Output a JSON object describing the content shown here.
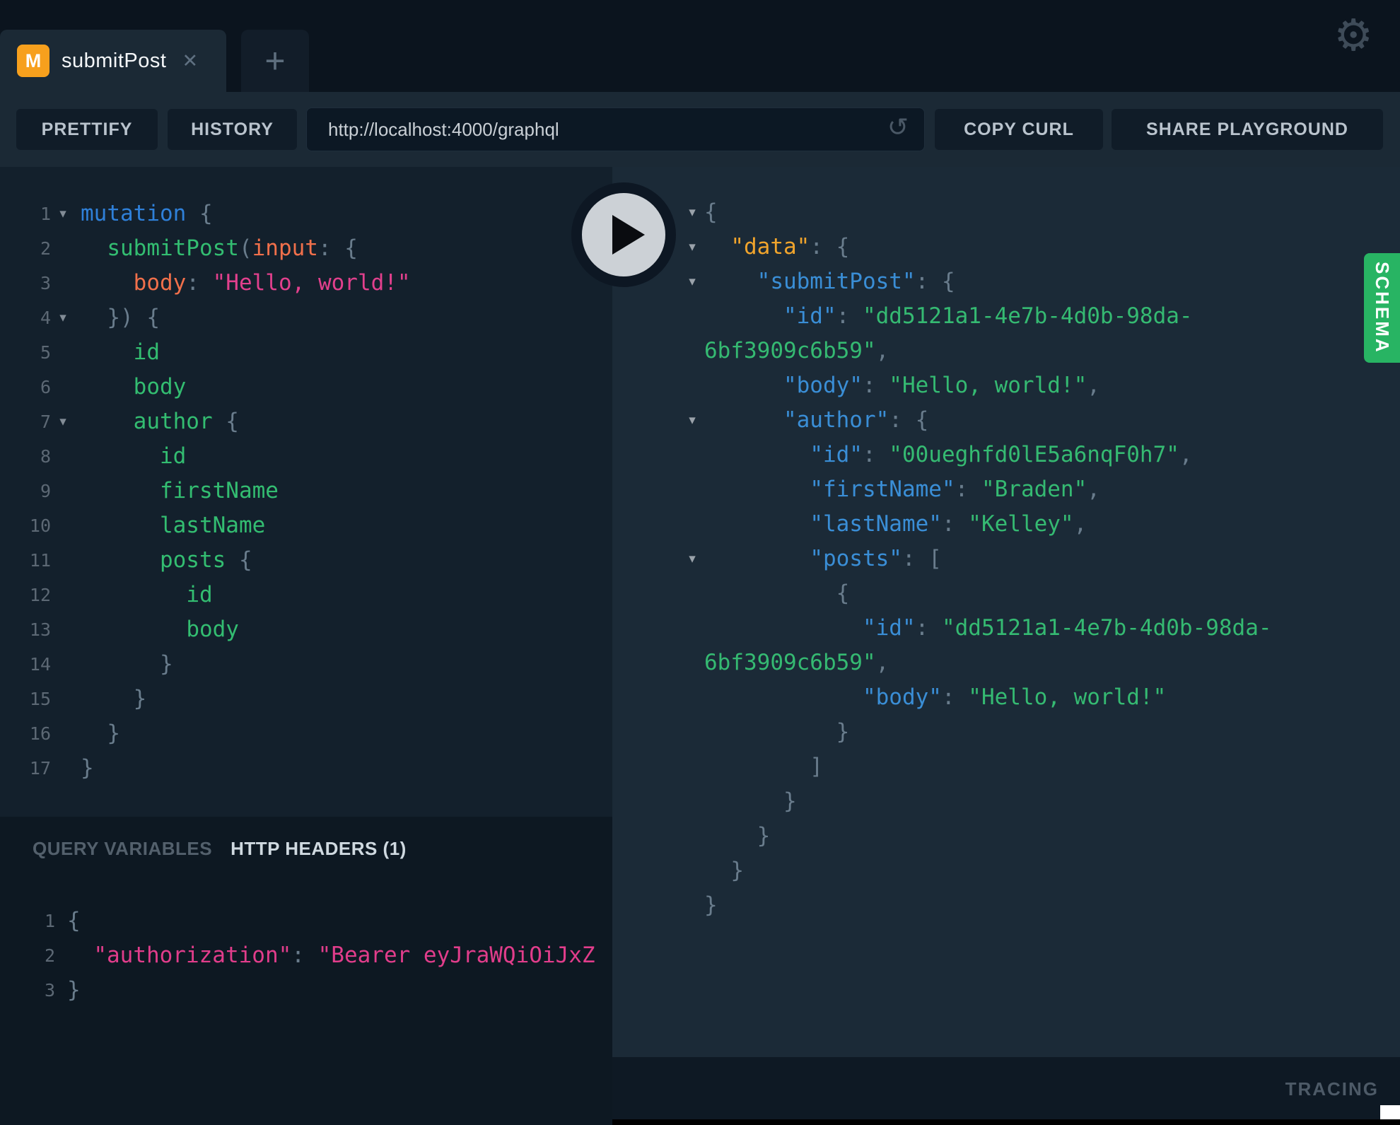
{
  "tabs": {
    "active": {
      "badge": "M",
      "title": "submitPost",
      "close_icon": "✕"
    },
    "new_tab_icon": "+"
  },
  "toolbar": {
    "prettify": "PRETTIFY",
    "history": "HISTORY",
    "url": "http://localhost:4000/graphql",
    "refresh_icon": "↺",
    "copy_curl": "COPY CURL",
    "share_playground": "SHARE PLAYGROUND"
  },
  "icons": {
    "gear": "⚙",
    "fold": "▾",
    "play": "play-triangle"
  },
  "colors": {
    "accent_green": "#28b463",
    "tab_badge_orange": "#f7a01d",
    "keyword_blue": "#2f80d9",
    "field_green": "#33bd71",
    "argument_orange": "#f1704b",
    "string_pink": "#e2408d",
    "json_key_blue": "#3a8ed6",
    "json_data_orange": "#f0a42c",
    "json_string_green": "#35ba72",
    "punctuation_gray": "#697c8c"
  },
  "query_editor": {
    "lines": [
      {
        "n": 1,
        "fold": true,
        "tokens": [
          [
            "kw",
            "mutation"
          ],
          [
            "pun",
            " {"
          ]
        ]
      },
      {
        "n": 2,
        "tokens": [
          [
            "pun",
            "  "
          ],
          [
            "fld",
            "submitPost"
          ],
          [
            "pun",
            "("
          ],
          [
            "attr",
            "input"
          ],
          [
            "pun",
            ": {"
          ]
        ]
      },
      {
        "n": 3,
        "tokens": [
          [
            "pun",
            "    "
          ],
          [
            "attr",
            "body"
          ],
          [
            "pun",
            ": "
          ],
          [
            "str",
            "\"Hello, world!\""
          ]
        ]
      },
      {
        "n": 4,
        "fold": true,
        "tokens": [
          [
            "pun",
            "  }) {"
          ]
        ]
      },
      {
        "n": 5,
        "tokens": [
          [
            "pun",
            "    "
          ],
          [
            "fld",
            "id"
          ]
        ]
      },
      {
        "n": 6,
        "tokens": [
          [
            "pun",
            "    "
          ],
          [
            "fld",
            "body"
          ]
        ]
      },
      {
        "n": 7,
        "fold": true,
        "tokens": [
          [
            "pun",
            "    "
          ],
          [
            "fld",
            "author"
          ],
          [
            "pun",
            " {"
          ]
        ]
      },
      {
        "n": 8,
        "tokens": [
          [
            "pun",
            "      "
          ],
          [
            "fld",
            "id"
          ]
        ]
      },
      {
        "n": 9,
        "tokens": [
          [
            "pun",
            "      "
          ],
          [
            "fld",
            "firstName"
          ]
        ]
      },
      {
        "n": 10,
        "tokens": [
          [
            "pun",
            "      "
          ],
          [
            "fld",
            "lastName"
          ]
        ]
      },
      {
        "n": 11,
        "tokens": [
          [
            "pun",
            "      "
          ],
          [
            "fld",
            "posts"
          ],
          [
            "pun",
            " {"
          ]
        ]
      },
      {
        "n": 12,
        "tokens": [
          [
            "pun",
            "        "
          ],
          [
            "fld",
            "id"
          ]
        ]
      },
      {
        "n": 13,
        "tokens": [
          [
            "pun",
            "        "
          ],
          [
            "fld",
            "body"
          ]
        ]
      },
      {
        "n": 14,
        "tokens": [
          [
            "pun",
            "      }"
          ]
        ]
      },
      {
        "n": 15,
        "tokens": [
          [
            "pun",
            "    }"
          ]
        ]
      },
      {
        "n": 16,
        "tokens": [
          [
            "pun",
            "  }"
          ]
        ]
      },
      {
        "n": 17,
        "tokens": [
          [
            "pun",
            "}"
          ]
        ]
      }
    ]
  },
  "results": {
    "lines": [
      {
        "fold": true,
        "tokens": [
          [
            "pun",
            "{"
          ]
        ]
      },
      {
        "fold": true,
        "tokens": [
          [
            "pun",
            "  "
          ],
          [
            "okey",
            "\"data\""
          ],
          [
            "pun",
            ": {"
          ]
        ]
      },
      {
        "fold": true,
        "tokens": [
          [
            "pun",
            "    "
          ],
          [
            "key",
            "\"submitPost\""
          ],
          [
            "pun",
            ": {"
          ]
        ]
      },
      {
        "tokens": [
          [
            "pun",
            "      "
          ],
          [
            "key",
            "\"id\""
          ],
          [
            "pun",
            ": "
          ],
          [
            "val",
            "\"dd5121a1-4e7b-4d0b-98da-"
          ]
        ]
      },
      {
        "tokens": [
          [
            "val",
            "6bf3909c6b59\""
          ],
          [
            "pun",
            ","
          ]
        ]
      },
      {
        "tokens": [
          [
            "pun",
            "      "
          ],
          [
            "key",
            "\"body\""
          ],
          [
            "pun",
            ": "
          ],
          [
            "val",
            "\"Hello, world!\""
          ],
          [
            "pun",
            ","
          ]
        ]
      },
      {
        "fold": true,
        "tokens": [
          [
            "pun",
            "      "
          ],
          [
            "key",
            "\"author\""
          ],
          [
            "pun",
            ": {"
          ]
        ]
      },
      {
        "tokens": [
          [
            "pun",
            "        "
          ],
          [
            "key",
            "\"id\""
          ],
          [
            "pun",
            ": "
          ],
          [
            "val",
            "\"00ueghfd0lE5a6nqF0h7\""
          ],
          [
            "pun",
            ","
          ]
        ]
      },
      {
        "tokens": [
          [
            "pun",
            "        "
          ],
          [
            "key",
            "\"firstName\""
          ],
          [
            "pun",
            ": "
          ],
          [
            "val",
            "\"Braden\""
          ],
          [
            "pun",
            ","
          ]
        ]
      },
      {
        "tokens": [
          [
            "pun",
            "        "
          ],
          [
            "key",
            "\"lastName\""
          ],
          [
            "pun",
            ": "
          ],
          [
            "val",
            "\"Kelley\""
          ],
          [
            "pun",
            ","
          ]
        ]
      },
      {
        "fold": true,
        "tokens": [
          [
            "pun",
            "        "
          ],
          [
            "key",
            "\"posts\""
          ],
          [
            "pun",
            ": ["
          ]
        ]
      },
      {
        "tokens": [
          [
            "pun",
            "          {"
          ]
        ]
      },
      {
        "tokens": [
          [
            "pun",
            "            "
          ],
          [
            "key",
            "\"id\""
          ],
          [
            "pun",
            ": "
          ],
          [
            "val",
            "\"dd5121a1-4e7b-4d0b-98da-"
          ]
        ]
      },
      {
        "tokens": [
          [
            "val",
            "6bf3909c6b59\""
          ],
          [
            "pun",
            ","
          ]
        ]
      },
      {
        "tokens": [
          [
            "pun",
            "            "
          ],
          [
            "key",
            "\"body\""
          ],
          [
            "pun",
            ": "
          ],
          [
            "val",
            "\"Hello, world!\""
          ]
        ]
      },
      {
        "tokens": [
          [
            "pun",
            "          }"
          ]
        ]
      },
      {
        "tokens": [
          [
            "pun",
            "        ]"
          ]
        ]
      },
      {
        "tokens": [
          [
            "pun",
            "      }"
          ]
        ]
      },
      {
        "tokens": [
          [
            "pun",
            "    }"
          ]
        ]
      },
      {
        "tokens": [
          [
            "pun",
            "  }"
          ]
        ]
      },
      {
        "tokens": [
          [
            "pun",
            "}"
          ]
        ]
      }
    ]
  },
  "bottom_panel": {
    "tabs": [
      {
        "label": "QUERY VARIABLES",
        "active": false
      },
      {
        "label": "HTTP HEADERS (1)",
        "active": true
      }
    ],
    "headers_editor": {
      "lines": [
        {
          "n": 1,
          "tokens": [
            [
              "pun",
              "{"
            ]
          ]
        },
        {
          "n": 2,
          "tokens": [
            [
              "pun",
              "  "
            ],
            [
              "hkey",
              "\"authorization\""
            ],
            [
              "pun",
              ": "
            ],
            [
              "hstr",
              "\"Bearer eyJraWQiOiJxZ"
            ]
          ]
        },
        {
          "n": 3,
          "tokens": [
            [
              "pun",
              "}"
            ]
          ]
        }
      ]
    }
  },
  "schema_tab_label": "SCHEMA",
  "tracing_label": "TRACING"
}
